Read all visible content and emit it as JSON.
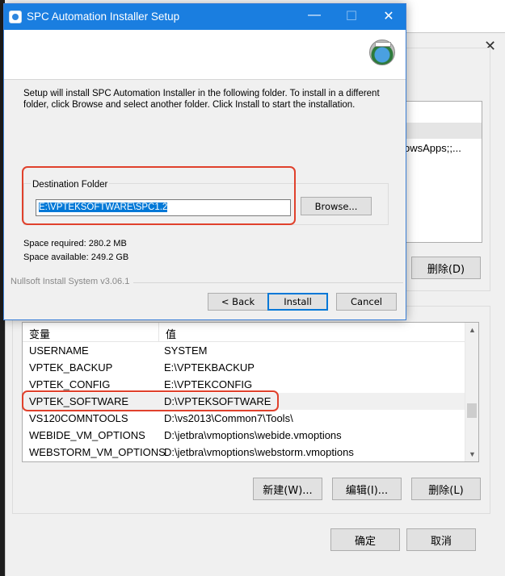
{
  "installer": {
    "title": "SPC Automation Installer Setup",
    "minimize": "—",
    "maximize": "☐",
    "close": "✕",
    "description": "Setup will install SPC Automation Installer in the following folder. To install in a different folder, click Browse and select another folder. Click Install to start the installation.",
    "destination_label": "Destination Folder",
    "destination_path": "E:\\VPTEKSOFTWARE\\SPC1.2",
    "browse_label": "Browse...",
    "space_required": "Space required: 280.2 MB",
    "space_available": "Space available: 249.2 GB",
    "footer": "Nullsoft Install System v3.06.1",
    "back_label": "< Back",
    "install_label": "Install",
    "cancel_label": "Cancel"
  },
  "env_dialog": {
    "close": "✕",
    "user_list_fragment": "owsApps;;...",
    "user_delete_label": "删除(D)",
    "table_header": {
      "variable": "变量",
      "value": "值"
    },
    "rows": [
      {
        "name": "USERNAME",
        "value": "SYSTEM"
      },
      {
        "name": "VPTEK_BACKUP",
        "value": "E:\\VPTEKBACKUP"
      },
      {
        "name": "VPTEK_CONFIG",
        "value": "E:\\VPTEKCONFIG"
      },
      {
        "name": "VPTEK_SOFTWARE",
        "value": "D:\\VPTEKSOFTWARE"
      },
      {
        "name": "VS120COMNTOOLS",
        "value": "D:\\vs2013\\Common7\\Tools\\"
      },
      {
        "name": "WEBIDE_VM_OPTIONS",
        "value": "D:\\jetbra\\vmoptions\\webide.vmoptions"
      },
      {
        "name": "WEBSTORM_VM_OPTIONS",
        "value": "D:\\jetbra\\vmoptions\\webstorm.vmoptions"
      }
    ],
    "new_label": "新建(W)...",
    "edit_label": "编辑(I)...",
    "delete_label": "删除(L)",
    "ok_label": "确定",
    "cancel_label": "取消"
  },
  "colors": {
    "titlebar": "#1a7ee0",
    "highlight_box": "#e0412c",
    "selection": "#0078d7"
  }
}
